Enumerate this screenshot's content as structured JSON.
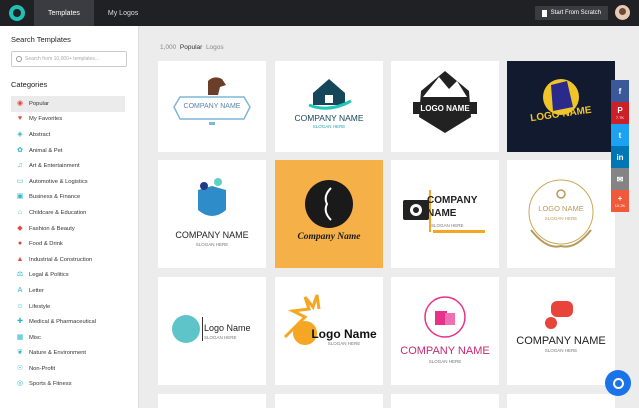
{
  "topbar": {
    "tabs": [
      {
        "label": "Templates",
        "active": true
      },
      {
        "label": "My Logos",
        "active": false
      }
    ],
    "start_button": "Start From Scratch"
  },
  "sidebar": {
    "search_title": "Search Templates",
    "search_placeholder": "Search from 10,000+ templates...",
    "categories_title": "Categories",
    "items": [
      {
        "label": "Popular",
        "icon": "popular-icon",
        "selected": true
      },
      {
        "label": "My Favorites",
        "icon": "heart-icon"
      },
      {
        "label": "Abstract",
        "icon": "abstract-icon"
      },
      {
        "label": "Animal & Pet",
        "icon": "paw-icon"
      },
      {
        "label": "Art & Entertainment",
        "icon": "music-icon"
      },
      {
        "label": "Automotive & Logistics",
        "icon": "car-icon"
      },
      {
        "label": "Business & Finance",
        "icon": "briefcase-icon"
      },
      {
        "label": "Childcare & Education",
        "icon": "education-icon"
      },
      {
        "label": "Fashion & Beauty",
        "icon": "diamond-icon"
      },
      {
        "label": "Food & Drink",
        "icon": "food-icon"
      },
      {
        "label": "Industrial & Construction",
        "icon": "construction-icon"
      },
      {
        "label": "Legal & Politics",
        "icon": "legal-icon"
      },
      {
        "label": "Letter",
        "icon": "letter-icon"
      },
      {
        "label": "Lifestyle",
        "icon": "lifestyle-icon"
      },
      {
        "label": "Medical & Pharmaceutical",
        "icon": "medical-icon"
      },
      {
        "label": "Misc",
        "icon": "misc-icon"
      },
      {
        "label": "Nature & Environment",
        "icon": "nature-icon"
      },
      {
        "label": "Non-Profit",
        "icon": "nonprofit-icon"
      },
      {
        "label": "Sports & Fitness",
        "icon": "sports-icon"
      }
    ]
  },
  "main": {
    "count": "1,000",
    "filter": "Popular",
    "noun": "Logos",
    "cards": [
      {
        "name": "COMPANY NAME",
        "slogan": ""
      },
      {
        "name": "COMPANY NAME",
        "slogan": "SLOGAN HERE"
      },
      {
        "name": "LOGO NAME",
        "slogan": ""
      },
      {
        "name": "LOGO NAME",
        "slogan": ""
      },
      {
        "name": "COMPANY NAME",
        "slogan": "SLOGAN HERE"
      },
      {
        "name": "Company Name",
        "slogan": ""
      },
      {
        "name": "COMPANY NAME",
        "slogan": "SLOGAN HERE"
      },
      {
        "name": "LOGO NAME",
        "slogan": "SLOGAN HERE"
      },
      {
        "name": "Logo Name",
        "slogan": "SLOGAN HERE"
      },
      {
        "name": "Logo Name",
        "slogan": "SLOGAN HERE"
      },
      {
        "name": "COMPANY NAME",
        "slogan": "SLOGAN HERE"
      },
      {
        "name": "COMPANY NAME",
        "slogan": "SLOGAN HERE"
      }
    ]
  },
  "share": [
    {
      "icon": "facebook-icon",
      "glyph": "f",
      "count": "",
      "color": "#3b5998"
    },
    {
      "icon": "pinterest-icon",
      "glyph": "P",
      "count": "7.7K",
      "color": "#cb2027"
    },
    {
      "icon": "twitter-icon",
      "glyph": "t",
      "count": "",
      "color": "#1da1f2"
    },
    {
      "icon": "linkedin-icon",
      "glyph": "in",
      "count": "",
      "color": "#0077b5"
    },
    {
      "icon": "email-icon",
      "glyph": "✉",
      "count": "",
      "color": "#848484"
    },
    {
      "icon": "share-more-icon",
      "glyph": "+",
      "count": "10.2K",
      "color": "#f05a3b"
    }
  ],
  "chat_icon": "chat-icon"
}
